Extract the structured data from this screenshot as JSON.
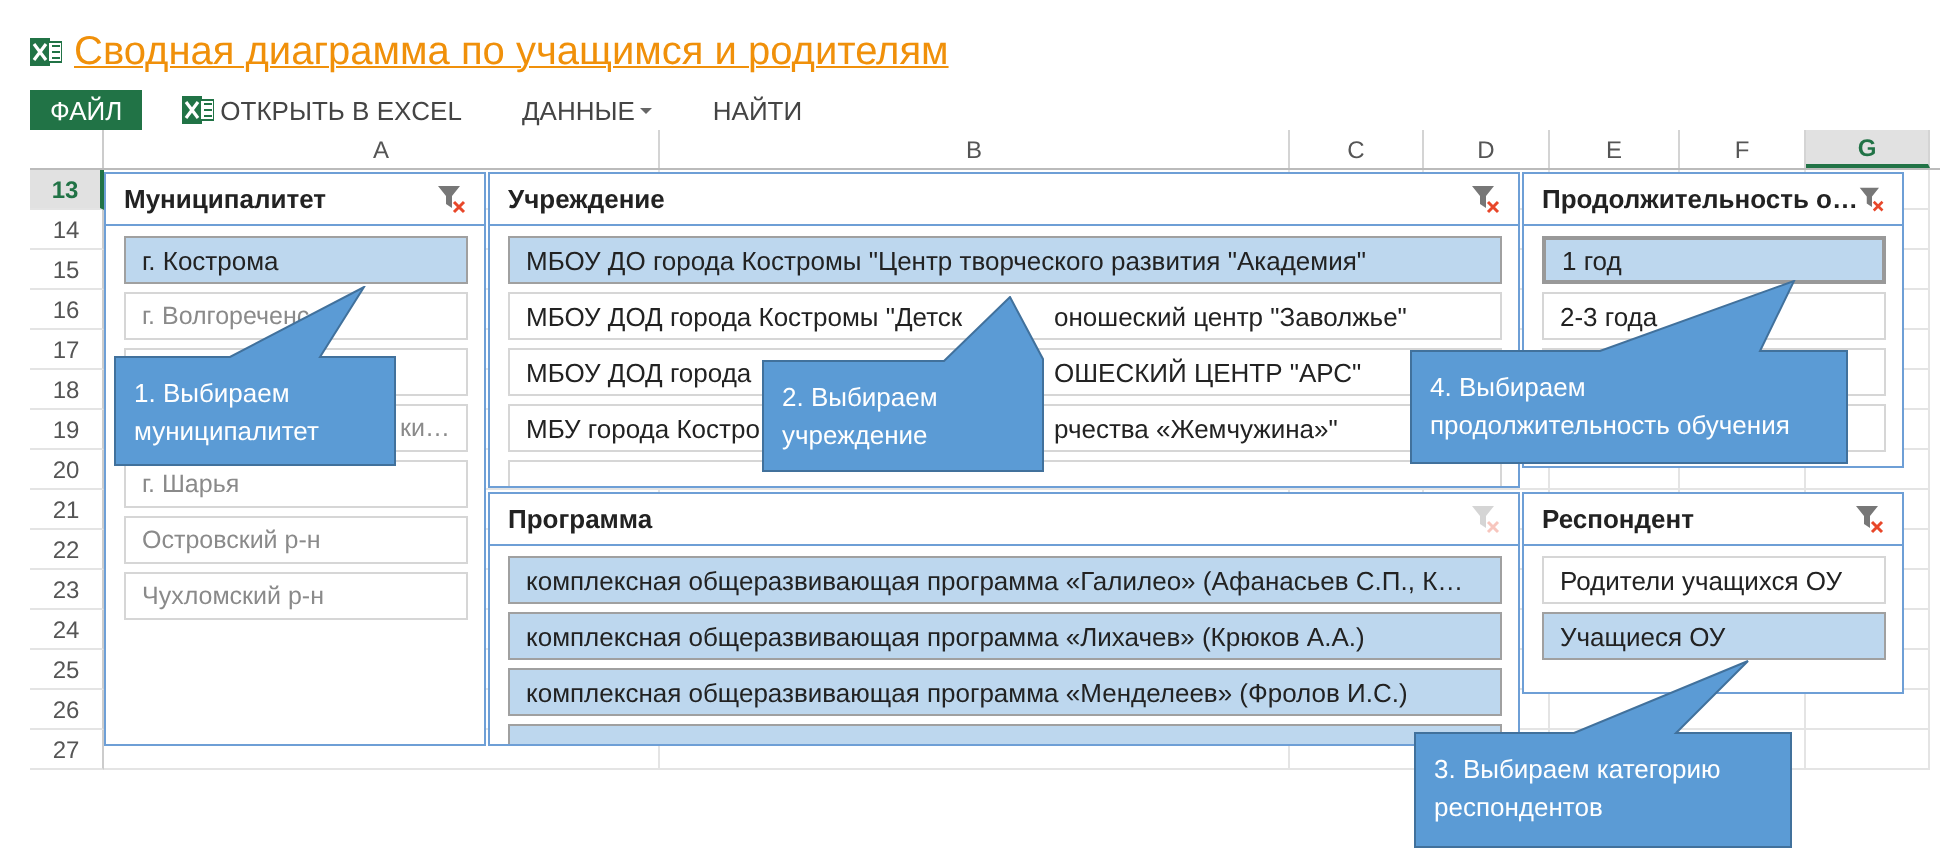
{
  "title": "Сводная диаграмма по учащимся и родителям",
  "toolbar": [
    {
      "kind": "file",
      "label": "ФАЙЛ"
    },
    {
      "kind": "excel",
      "label": "ОТКРЫТЬ В EXCEL"
    },
    {
      "kind": "menu",
      "label": "ДАННЫЕ"
    },
    {
      "kind": "plain",
      "label": "НАЙТИ"
    }
  ],
  "columns": [
    {
      "label": "A",
      "selected": false
    },
    {
      "label": "B",
      "selected": false
    },
    {
      "label": "C",
      "selected": false
    },
    {
      "label": "D",
      "selected": false
    },
    {
      "label": "E",
      "selected": false
    },
    {
      "label": "F",
      "selected": false
    },
    {
      "label": "G",
      "selected": true
    }
  ],
  "rows": [
    {
      "label": "13",
      "selected": true
    },
    {
      "label": "14",
      "selected": false
    },
    {
      "label": "15",
      "selected": false
    },
    {
      "label": "16",
      "selected": false
    },
    {
      "label": "17",
      "selected": false
    },
    {
      "label": "18",
      "selected": false
    },
    {
      "label": "19",
      "selected": false
    },
    {
      "label": "20",
      "selected": false
    },
    {
      "label": "21",
      "selected": false
    },
    {
      "label": "22",
      "selected": false
    },
    {
      "label": "23",
      "selected": false
    },
    {
      "label": "24",
      "selected": false
    },
    {
      "label": "25",
      "selected": false
    },
    {
      "label": "26",
      "selected": false
    },
    {
      "label": "27",
      "selected": false
    }
  ],
  "slicers": [
    {
      "title": "Муниципалитет",
      "filtered": true,
      "items": [
        {
          "text": "г. Кострома",
          "selected": true,
          "has_data": true
        },
        {
          "text": "г. Волгореченс",
          "selected": false,
          "has_data": false
        },
        {
          "selected": false
        },
        {
          "text": "ки…",
          "selected": false,
          "has_data": false,
          "partial": true
        },
        {
          "text": "г. Шарья",
          "selected": false,
          "has_data": false
        },
        {
          "text": "Островский р-н",
          "selected": false,
          "has_data": false
        },
        {
          "text": "Чухломский р-н",
          "selected": false,
          "has_data": false
        }
      ]
    },
    {
      "title": "Учреждение",
      "filtered": true,
      "items": [
        {
          "text": "МБОУ ДО города Костромы \"Центр творческого развития \"Академия\"",
          "selected": true,
          "has_data": true
        },
        {
          "parts": [
            "МБОУ ДОД города Костромы \"Детск",
            "оношеский центр \"Заволжье\""
          ],
          "selected": false,
          "has_data": true
        },
        {
          "parts": [
            "МБОУ ДОД города",
            "ОШЕСКИЙ ЦЕНТР \"АРС\""
          ],
          "selected": false,
          "has_data": true
        },
        {
          "parts": [
            "МБУ города Костро",
            "рчества «Жемчужина»\""
          ],
          "selected": false,
          "has_data": true
        },
        {
          "selected": false
        }
      ]
    },
    {
      "title": "Программа",
      "filtered": false,
      "items": [
        {
          "text": "комплексная общеразвивающая программа «Галилео» (Афанасьев С.П., К…",
          "selected": true,
          "has_data": true
        },
        {
          "text": "комплексная общеразвивающая программа «Лихачев» (Крюков А.А.)",
          "selected": true,
          "has_data": true
        },
        {
          "text": "комплексная общеразвивающая программа «Менделеев» (Фролов И.С.)",
          "selected": true,
          "has_data": true
        },
        {
          "selected": true
        }
      ]
    },
    {
      "title": "Продолжительность о…",
      "filtered": true,
      "items": [
        {
          "text": "1 год",
          "selected": true,
          "has_data": true
        },
        {
          "text": "2-3 года",
          "selected": false,
          "has_data": true
        },
        {
          "selected": false
        },
        {
          "selected": false
        }
      ]
    },
    {
      "title": "Респондент",
      "filtered": true,
      "items": [
        {
          "text": "Родители учащихся ОУ",
          "selected": false,
          "has_data": true
        },
        {
          "text": "Учащиеся ОУ",
          "selected": true,
          "has_data": true
        }
      ]
    }
  ],
  "callouts": [
    {
      "text": "1. Выбираем муниципалитет"
    },
    {
      "text": "2. Выбираем учреждение"
    },
    {
      "text": "4. Выбираем продолжительность обучения"
    },
    {
      "text": "3. Выбираем категорию респондентов"
    }
  ]
}
